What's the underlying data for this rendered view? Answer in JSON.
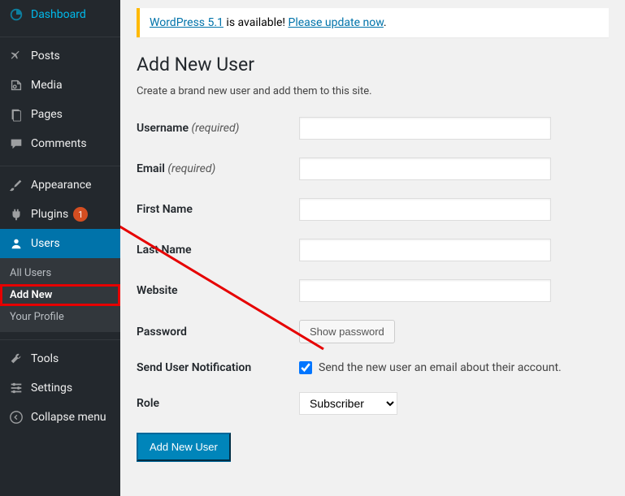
{
  "sidebar": {
    "items": [
      {
        "label": "Dashboard",
        "icon": "dashboard"
      },
      {
        "label": "Posts",
        "icon": "pin"
      },
      {
        "label": "Media",
        "icon": "media"
      },
      {
        "label": "Pages",
        "icon": "page"
      },
      {
        "label": "Comments",
        "icon": "comment"
      },
      {
        "label": "Appearance",
        "icon": "brush"
      },
      {
        "label": "Plugins",
        "icon": "plug",
        "badge": "1"
      },
      {
        "label": "Users",
        "icon": "user",
        "active": true
      },
      {
        "label": "Tools",
        "icon": "wrench"
      },
      {
        "label": "Settings",
        "icon": "sliders"
      },
      {
        "label": "Collapse menu",
        "icon": "collapse"
      }
    ],
    "submenu": {
      "items": [
        {
          "label": "All Users"
        },
        {
          "label": "Add New",
          "current": true
        },
        {
          "label": "Your Profile"
        }
      ]
    }
  },
  "notice": {
    "link1": "WordPress 5.1",
    "text": " is available! ",
    "link2": "Please update now",
    "suffix": "."
  },
  "page": {
    "title": "Add New User",
    "subtitle": "Create a brand new user and add them to this site."
  },
  "form": {
    "username_label": "Username ",
    "username_req": "(required)",
    "email_label": "Email ",
    "email_req": "(required)",
    "firstname_label": "First Name",
    "lastname_label": "Last Name",
    "website_label": "Website",
    "password_label": "Password",
    "show_password_btn": "Show password",
    "notification_label": "Send User Notification",
    "notification_text": "Send the new user an email about their account.",
    "role_label": "Role",
    "role_value": "Subscriber",
    "submit": "Add New User"
  }
}
